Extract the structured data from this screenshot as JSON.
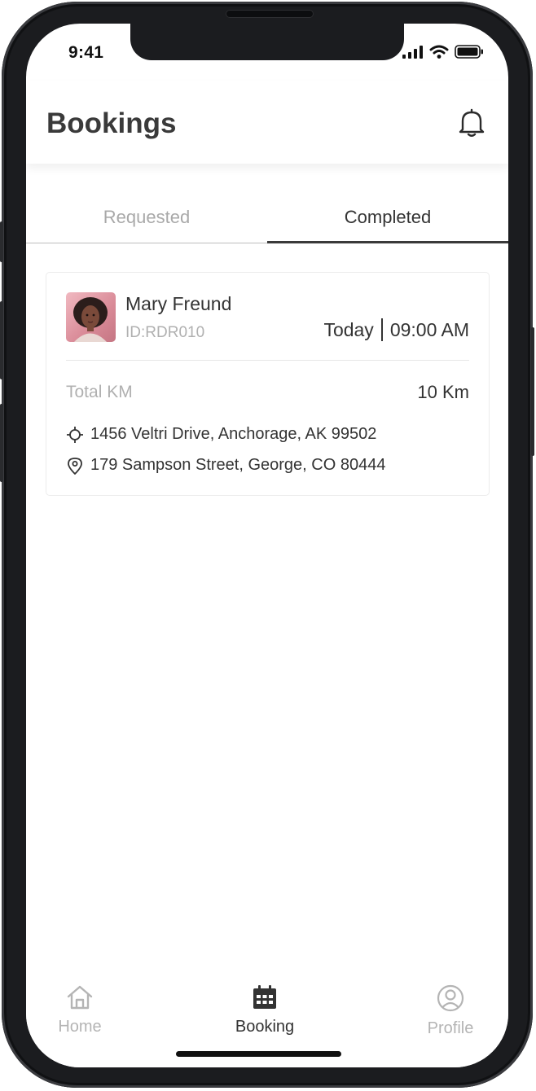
{
  "status_bar": {
    "time": "9:41"
  },
  "header": {
    "title": "Bookings",
    "notification_icon": "bell-icon"
  },
  "tabs": [
    {
      "label": "Requested",
      "active": false
    },
    {
      "label": "Completed",
      "active": true
    }
  ],
  "booking": {
    "rider_name": "Mary Freund",
    "rider_id": "ID:RDR010",
    "day": "Today",
    "time": "09:00 AM",
    "total_km_label": "Total KM",
    "total_km_value": "10 Km",
    "pickup_icon": "crosshair-icon",
    "pickup_address": "1456 Veltri Drive, Anchorage, AK 99502",
    "drop_icon": "map-pin-icon",
    "drop_address": "179 Sampson Street, George, CO 80444"
  },
  "bottom_nav": [
    {
      "label": "Home",
      "icon": "home-icon",
      "active": false
    },
    {
      "label": "Booking",
      "icon": "calendar-icon",
      "active": true
    },
    {
      "label": "Profile",
      "icon": "user-circle-icon",
      "active": false
    }
  ],
  "colors": {
    "text_primary": "#333333",
    "text_muted": "#b0b0b0",
    "frame": "#1b1c1f"
  }
}
